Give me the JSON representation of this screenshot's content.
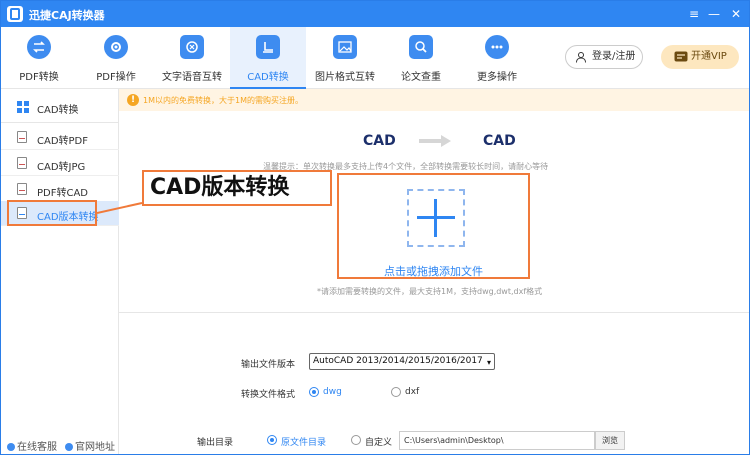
{
  "app": {
    "title": "迅捷CAJ转换器"
  },
  "window_controls": {
    "menu": "≡",
    "minimize": "—",
    "close": "✕"
  },
  "toolbar": {
    "tools": [
      {
        "label": "PDF转换",
        "icon": "pdf-convert-icon"
      },
      {
        "label": "PDF操作",
        "icon": "pdf-operate-icon"
      },
      {
        "label": "文字语音互转",
        "icon": "text-speech-icon"
      },
      {
        "label": "CAD转换",
        "icon": "cad-convert-icon",
        "active": true
      },
      {
        "label": "图片格式互转",
        "icon": "image-format-icon"
      },
      {
        "label": "论文查重",
        "icon": "paper-check-icon"
      },
      {
        "label": "更多操作",
        "icon": "more-icon"
      }
    ],
    "login_label": "登录/注册",
    "vip_label": "开通VIP"
  },
  "sidebar": {
    "header": "CAD转换",
    "items": [
      {
        "label": "CAD转PDF"
      },
      {
        "label": "CAD转JPG"
      },
      {
        "label": "PDF转CAD"
      },
      {
        "label": "CAD版本转换",
        "active": true
      }
    ],
    "footer": {
      "support": "在线客服",
      "website": "官网地址"
    }
  },
  "main": {
    "notice": "1M以内的免费转换，大于1M的需购买注册。",
    "conversion": {
      "from": "CAD",
      "to": "CAD"
    },
    "tip": "温馨提示：单次转换最多支持上传4个文件，全部转换需要较长时间，请耐心等待",
    "drop_label": "点击或拖拽添加文件",
    "drop_hint": "*请添加需要转换的文件，最大支持1M，支持dwg,dwt,dxf格式",
    "callout": "CAD版本转换",
    "output_version_label": "输出文件版本",
    "output_version_value": "AutoCAD 2013/2014/2015/2016/2017",
    "format_label": "转换文件格式",
    "format_options": [
      "dwg",
      "dxf"
    ],
    "format_selected": "dwg",
    "output_dir_label": "输出目录",
    "output_dir_options": [
      "原文件目录",
      "自定义"
    ],
    "output_dir_selected": "原文件目录",
    "path_value": "C:\\Users\\admin\\Desktop\\",
    "browse_label": "浏览"
  },
  "colors": {
    "brand": "#2f86f2",
    "highlight": "#f07a3a",
    "notice": "#f5a623"
  }
}
